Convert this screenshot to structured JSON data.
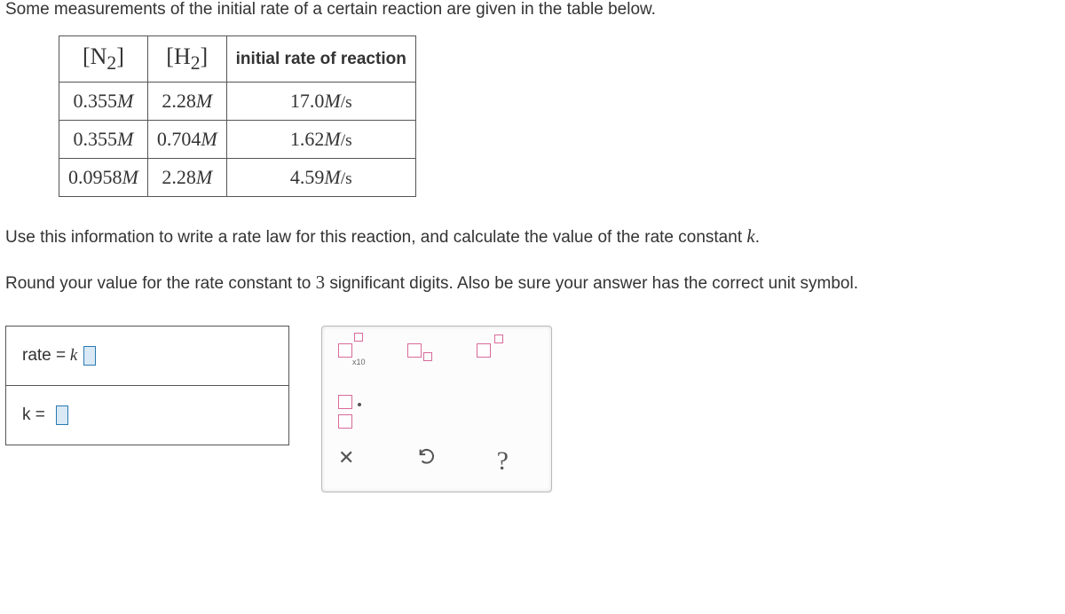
{
  "intro": "Some measurements of the initial rate of a certain reaction are given in the table below.",
  "table": {
    "headers": {
      "col1_species": "N",
      "col1_sub": "2",
      "col2_species": "H",
      "col2_sub": "2",
      "col3": "initial rate of reaction"
    },
    "rows": [
      {
        "n2": "0.355",
        "h2": "2.28",
        "rate": "17.0"
      },
      {
        "n2": "0.355",
        "h2": "0.704",
        "rate": "1.62"
      },
      {
        "n2": "0.0958",
        "h2": "2.28",
        "rate": "4.59"
      }
    ],
    "conc_unit": "M",
    "rate_unit_M": "M",
    "rate_unit_s": "/s"
  },
  "para1_a": "Use this information to write a rate law for this reaction, and calculate the value of the rate constant ",
  "para1_k": "k",
  "para1_b": ".",
  "para2_a": "Round your value for the rate constant to ",
  "para2_num": "3",
  "para2_b": " significant digits. Also be sure your answer has the correct unit symbol.",
  "answers": {
    "rate_label": "rate ",
    "eq": "=",
    "k": " k ",
    "k_label": "k ",
    "eq2": "="
  },
  "tools": {
    "x10": "x10",
    "clear": "✕",
    "help": "?"
  }
}
